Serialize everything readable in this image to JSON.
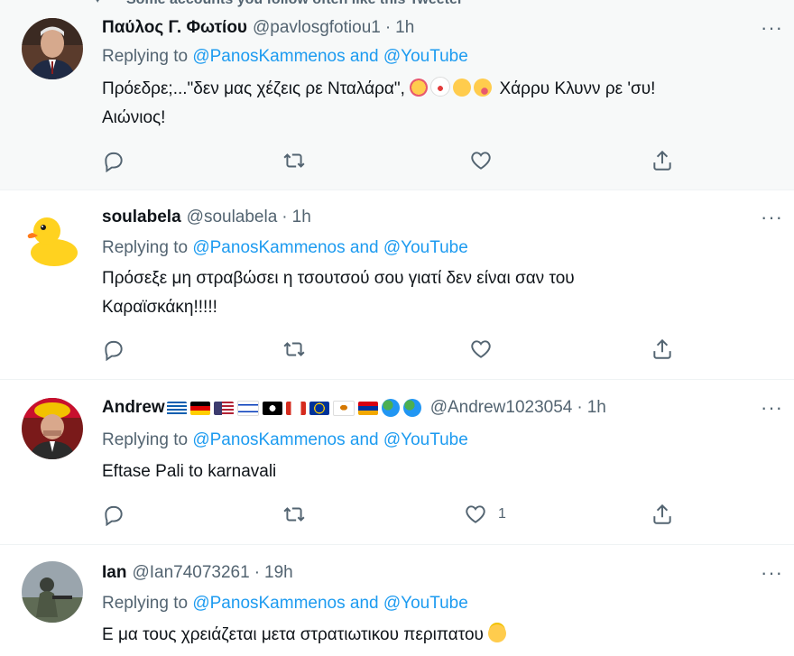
{
  "top_note": {
    "text": "Some accounts you follow often like this Tweeter"
  },
  "tweets": [
    {
      "name": "Παύλος Γ. Φωτίου",
      "handle": "@pavlosgfotiou1",
      "sep": "·",
      "time": "1h",
      "more": "···",
      "reply_prefix": "Replying to",
      "reply_targets": "@PanosKammenos and @YouTube",
      "text_line1_a": "Πρόεδρε;...\"δεν μας χέζεις ρε Νταλάρα\",",
      "text_line1_b": "Χάρρυ Κλυνν ρε 'συ!",
      "text_line2": "Αιώνιος!",
      "likes": ""
    },
    {
      "name": "soulabela",
      "handle": "@soulabela",
      "sep": "·",
      "time": "1h",
      "more": "···",
      "reply_prefix": "Replying to",
      "reply_targets": "@PanosKammenos and @YouTube",
      "text_line1": "Πρόσεξε μη στραβώσει η τσουτσού σου γιατί δεν είναι  σαν του",
      "text_line2": "Καραϊσκάκη!!!!!",
      "likes": ""
    },
    {
      "name": "Andrew",
      "handle": "@Andrew1023054",
      "sep": "·",
      "time": "1h",
      "more": "···",
      "reply_prefix": "Replying to",
      "reply_targets": "@PanosKammenos and @YouTube",
      "text_line1": "Eftase Pali to karnavali",
      "likes": "1"
    },
    {
      "name": "Ian",
      "handle": "@Ian74073261",
      "sep": "·",
      "time": "19h",
      "more": "···",
      "reply_prefix": "Replying to",
      "reply_targets": "@PanosKammenos and @YouTube",
      "text_line1": "Ε μα τους χρειάζεται μετα στρατιωτικου περιπατου",
      "likes": ""
    }
  ],
  "icons": [
    "reply-icon",
    "retweet-icon",
    "like-icon",
    "share-icon"
  ],
  "colors": {
    "link": "#1d9bf0",
    "muted": "#536471",
    "text": "#0f1419",
    "highlight_bg": "#f7f9f9"
  }
}
